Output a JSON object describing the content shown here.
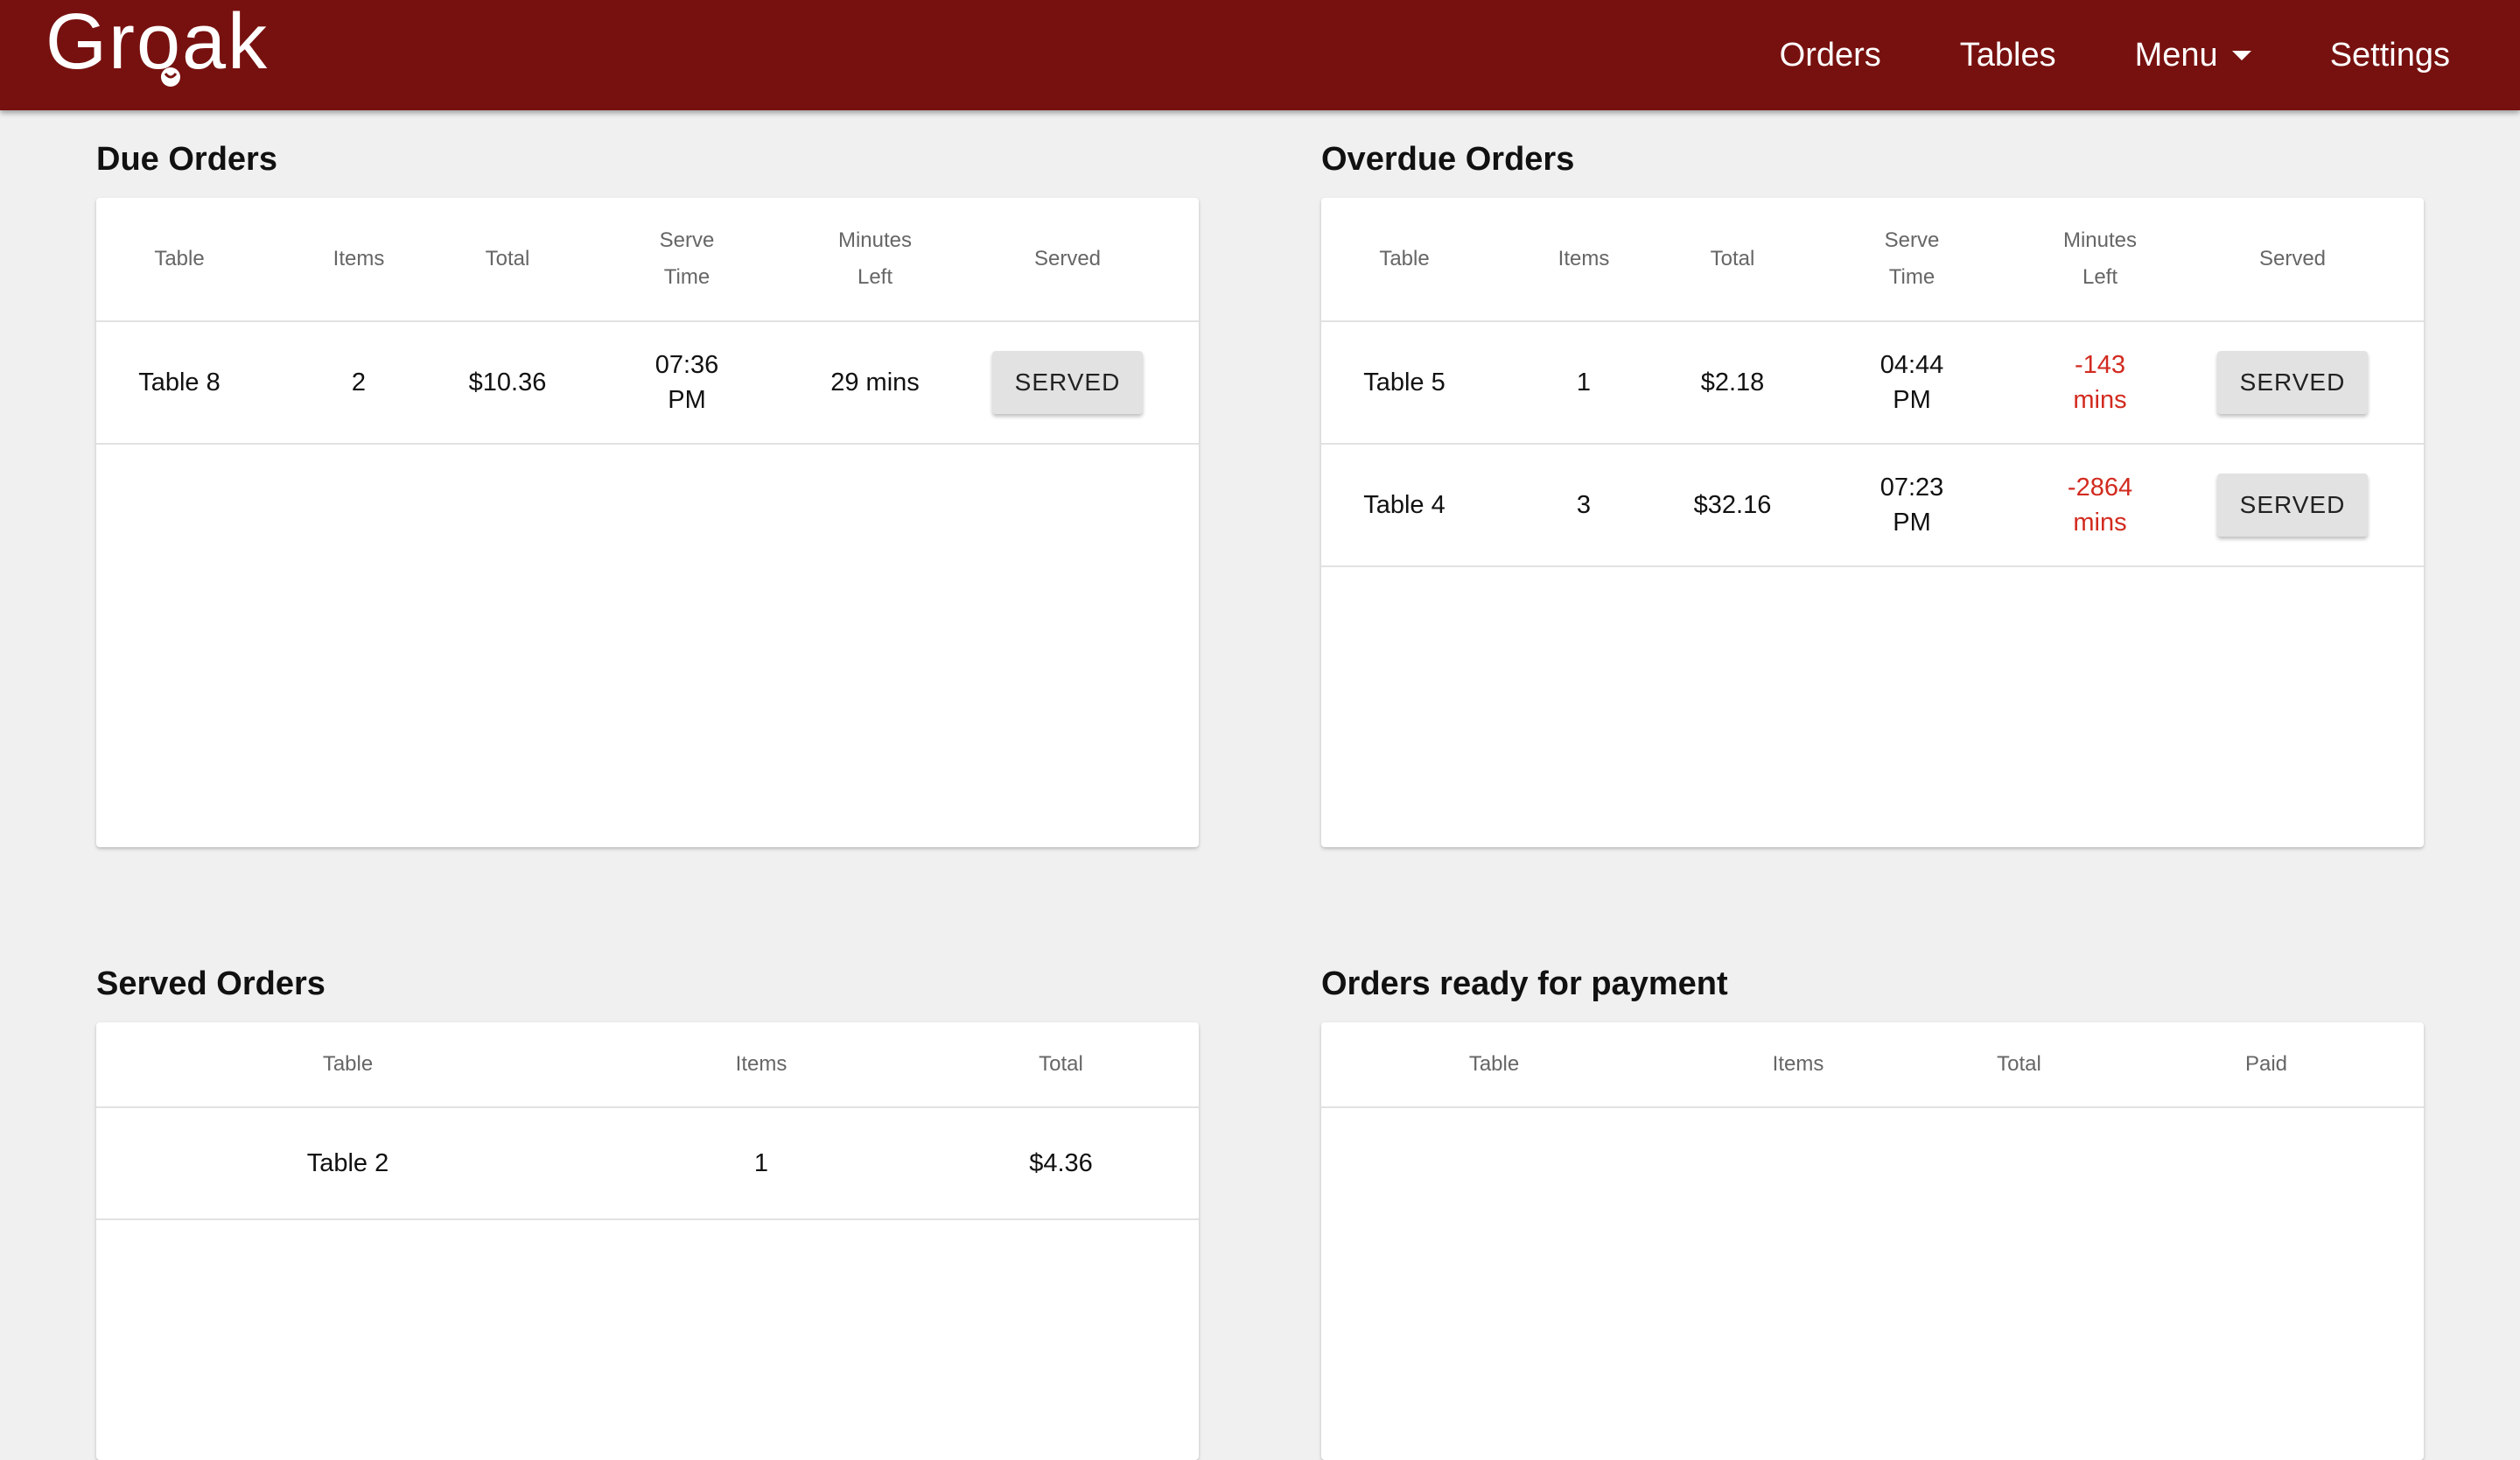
{
  "app": {
    "logo": "Groak",
    "nav": {
      "orders": "Orders",
      "tables": "Tables",
      "menu": "Menu",
      "settings": "Settings"
    }
  },
  "due": {
    "title": "Due Orders",
    "headers": {
      "table": "Table",
      "items": "Items",
      "total": "Total",
      "serve1": "Serve",
      "serve2": "Time",
      "min1": "Minutes",
      "min2": "Left",
      "served": "Served"
    },
    "rows": [
      {
        "table": "Table 8",
        "items": "2",
        "total": "$10.36",
        "time1": "07:36",
        "time2": "PM",
        "left1": "29 mins",
        "left2": "",
        "button": "SERVED"
      }
    ]
  },
  "overdue": {
    "title": "Overdue Orders",
    "headers": {
      "table": "Table",
      "items": "Items",
      "total": "Total",
      "serve1": "Serve",
      "serve2": "Time",
      "min1": "Minutes",
      "min2": "Left",
      "served": "Served"
    },
    "rows": [
      {
        "table": "Table 5",
        "items": "1",
        "total": "$2.18",
        "time1": "04:44",
        "time2": "PM",
        "left1": "-143",
        "left2": "mins",
        "button": "SERVED"
      },
      {
        "table": "Table 4",
        "items": "3",
        "total": "$32.16",
        "time1": "07:23",
        "time2": "PM",
        "left1": "-2864",
        "left2": "mins",
        "button": "SERVED"
      }
    ]
  },
  "served": {
    "title": "Served Orders",
    "headers": {
      "table": "Table",
      "items": "Items",
      "total": "Total"
    },
    "rows": [
      {
        "table": "Table 2",
        "items": "1",
        "total": "$4.36"
      }
    ]
  },
  "payment": {
    "title": "Orders ready for payment",
    "headers": {
      "table": "Table",
      "items": "Items",
      "total": "Total",
      "paid": "Paid"
    }
  },
  "colors": {
    "navbar": "#77110f",
    "overdue_text": "#d22a1f",
    "background": "#f0f0f0"
  }
}
